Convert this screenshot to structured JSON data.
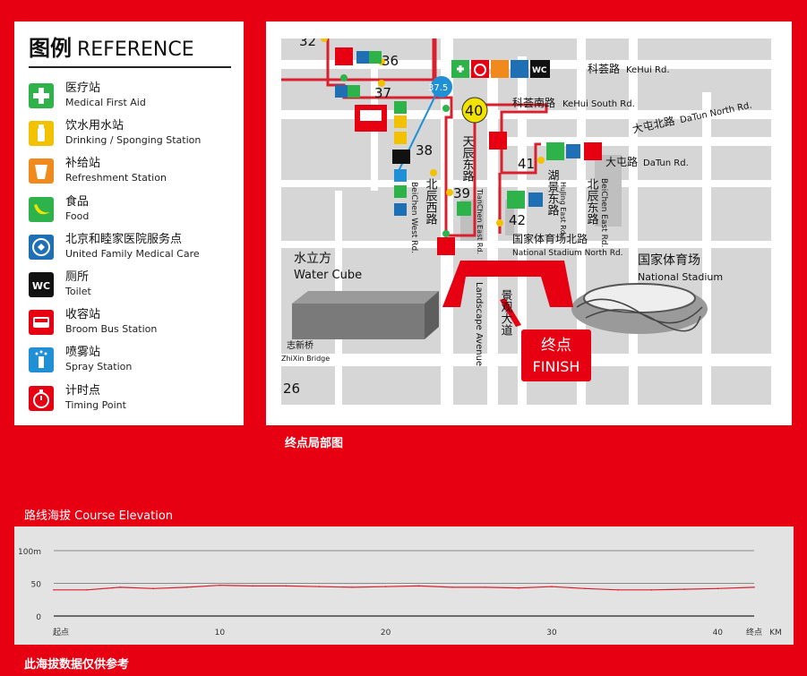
{
  "legend": {
    "title_zh": "图例",
    "title_en": "REFERENCE",
    "items": [
      {
        "zh": "医疗站",
        "en": "Medical First Aid",
        "icon": "first-aid-icon",
        "color": "#2db34a"
      },
      {
        "zh": "饮水用水站",
        "en": "Drinking / Sponging Station",
        "icon": "water-bottle-icon",
        "color": "#f2c200"
      },
      {
        "zh": "补给站",
        "en": "Refreshment Station",
        "icon": "refreshment-cup-icon",
        "color": "#f08a1c"
      },
      {
        "zh": "食品",
        "en": "Food",
        "icon": "banana-icon",
        "color": "#2db34a"
      },
      {
        "zh": "北京和睦家医院服务点",
        "en": "United Family Medical Care",
        "icon": "united-family-icon",
        "color": "#1f6fb5"
      },
      {
        "zh": "厕所",
        "en": "Toilet",
        "icon": "toilet-wc-icon",
        "color": "#111111"
      },
      {
        "zh": "收容站",
        "en": "Broom Bus Station",
        "icon": "bus-icon",
        "color": "#e60012"
      },
      {
        "zh": "喷雾站",
        "en": "Spray Station",
        "icon": "spray-icon",
        "color": "#1f8fd6"
      },
      {
        "zh": "计时点",
        "en": "Timing Point",
        "icon": "stopwatch-icon",
        "color": "#e60012"
      }
    ]
  },
  "map": {
    "caption": "终点局部图",
    "km_markers": [
      "32",
      "36",
      "37",
      "37.5",
      "38",
      "39",
      "40",
      "41",
      "42",
      "26"
    ],
    "roads": {
      "kehui_zh": "科荟路",
      "kehui_en": "KeHui Rd.",
      "kehui_south_zh": "科荟南路",
      "kehui_south_en": "KeHui South Rd.",
      "datun_north_zh": "大屯北路",
      "datun_north_en": "DaTun North Rd.",
      "datun_zh": "大屯路",
      "datun_en": "DaTun Rd.",
      "tianchen_zh": "天辰东路",
      "tianchen_en": "TianChen East Rd.",
      "beichen_west_zh": "北辰西路",
      "beichen_west_en": "BeiChen West Rd.",
      "hujing_zh": "湖景东路",
      "hujing_en": "HuJing East Rd.",
      "beichen_east_zh": "北辰东路",
      "beichen_east_en": "BeiChen East Rd.",
      "stadium_north_zh": "国家体育场北路",
      "stadium_north_en": "National Stadium North Rd.",
      "landscape_zh": "景观大道",
      "landscape_en": "Landscape Avenue"
    },
    "landmarks": {
      "water_cube_zh": "水立方",
      "water_cube_en": "Water Cube",
      "stadium_zh": "国家体育场",
      "stadium_en": "National Stadium",
      "bridge_zh": "志新桥",
      "bridge_en": "ZhiXin Bridge"
    },
    "finish_zh": "终点",
    "finish_en": "FINISH",
    "wc_label": "WC",
    "route_color": "#d9202f"
  },
  "elevation": {
    "title": "路线海拔 Course Elevation",
    "note": "此海拔数据仅供参考",
    "y_ticks": [
      "100m",
      "50",
      "0"
    ],
    "x_ticks": [
      "起点",
      "10",
      "20",
      "30",
      "40",
      "终点"
    ],
    "x_unit": "KM",
    "chart_data": {
      "type": "line",
      "title": "路线海拔 Course Elevation",
      "xlabel": "KM",
      "ylabel": "",
      "ylim": [
        0,
        100
      ],
      "xlim": [
        0,
        42.195
      ],
      "x": [
        0,
        2,
        4,
        6,
        8,
        10,
        12,
        14,
        16,
        18,
        20,
        22,
        24,
        26,
        28,
        30,
        32,
        34,
        36,
        38,
        40,
        42.195
      ],
      "y": [
        40,
        40,
        44,
        42,
        44,
        47,
        46,
        46,
        45,
        44,
        45,
        46,
        44,
        44,
        43,
        45,
        42,
        40,
        40,
        41,
        42,
        44
      ],
      "series": [
        {
          "values": [
            40,
            40,
            44,
            42,
            44,
            47,
            46,
            46,
            45,
            44,
            45,
            46,
            44,
            44,
            43,
            45,
            42,
            40,
            40,
            41,
            42,
            44
          ]
        }
      ],
      "grid": true,
      "line_color": "#d9202f"
    }
  }
}
